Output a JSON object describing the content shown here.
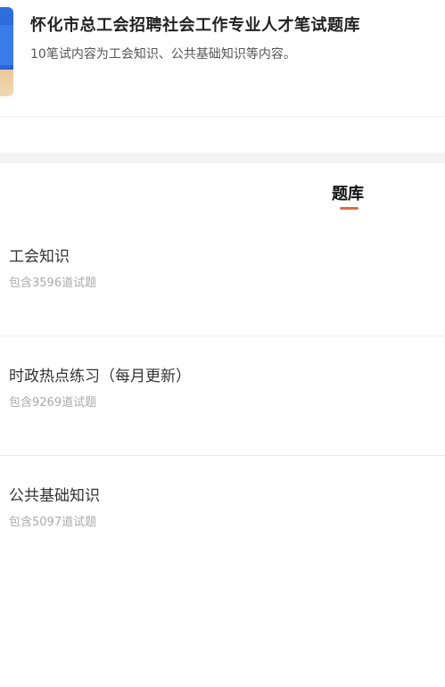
{
  "header": {
    "title": "怀化市总工会招聘社会工作专业人才笔试题库",
    "subtitle": "10笔试内容为工会知识、公共基础知识等内容。"
  },
  "tabs": [
    {
      "label": "题库",
      "active": true
    }
  ],
  "colors": {
    "accent": "#e36a3f"
  },
  "items": [
    {
      "title": "工会知识",
      "count": "包含3596道试题"
    },
    {
      "title": "时政热点练习（每月更新）",
      "count": "包含9269道试题"
    },
    {
      "title": "公共基础知识",
      "count": "包含5097道试题"
    }
  ]
}
